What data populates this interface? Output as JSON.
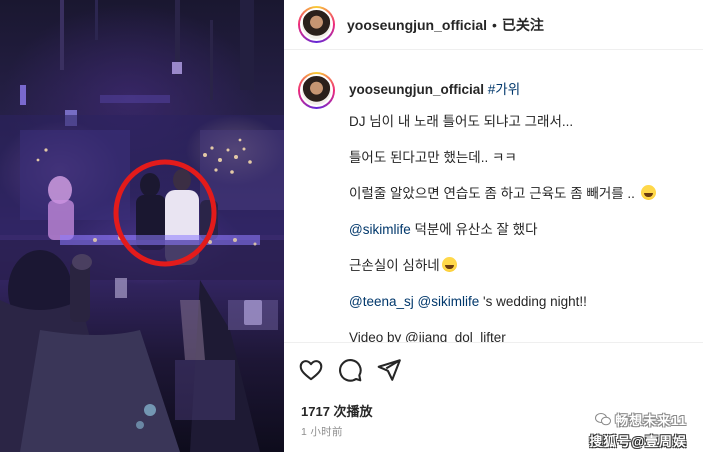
{
  "post": {
    "username": "yooseungjun_official",
    "dot": "•",
    "follow_status": "已关注"
  },
  "caption": {
    "username": "yooseungjun_official",
    "hashtag": "#가위",
    "line1": "DJ 님이 내 노래 틀어도 되냐고 그래서...",
    "line2": "틀어도 된다고만 했는데.. ㅋㅋ",
    "line3": "이럴줄 알았으면 연습도 좀 하고 근육도 좀 빼거를 ..",
    "line4_mention": "@sikimlife",
    "line4_text": " 덕분에 유산소 잘 했다",
    "line5": "근손실이 심하네",
    "line6_mention1": "@teena_sj",
    "line6_mention2": "@sikimlife",
    "line6_text": " 's wedding night!!",
    "line7": "Video by @jiang_dol_lifter"
  },
  "actions": {
    "like_icon": "heart-icon",
    "comment_icon": "comment-icon",
    "share_icon": "share-icon"
  },
  "stats": {
    "plays": "1717 次播放",
    "time_ago": "1 小时前"
  },
  "watermark": {
    "line1": "畅想未来11",
    "line2": "搜狐号@壹周娱"
  },
  "colors": {
    "link": "#00376b",
    "text": "#262626",
    "muted": "#8e8e8e",
    "highlight_circle": "#e31b1b"
  }
}
